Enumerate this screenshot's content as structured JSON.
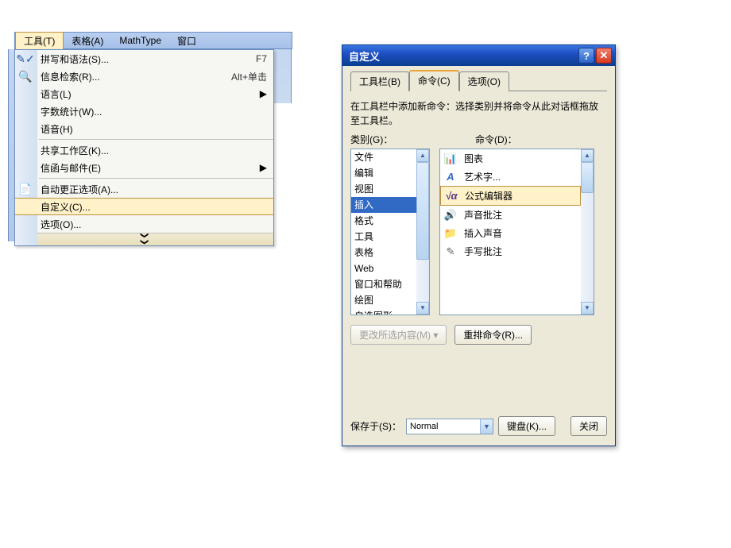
{
  "menubar": {
    "tools": "工具(T)",
    "table": "表格(A)",
    "mathtype": "MathType",
    "window_partial": "窗口"
  },
  "menu": {
    "spelling": {
      "label": "拼写和语法(S)...",
      "shortcut": "F7"
    },
    "research": {
      "label": "信息检索(R)...",
      "shortcut": "Alt+单击"
    },
    "language": {
      "label": "语言(L)"
    },
    "wordcount": {
      "label": "字数统计(W)..."
    },
    "speech": {
      "label": "语音(H)"
    },
    "sharedws": {
      "label": "共享工作区(K)..."
    },
    "letters": {
      "label": "信函与邮件(E)"
    },
    "autocorrect": {
      "label": "自动更正选项(A)..."
    },
    "customize": {
      "label": "自定义(C)..."
    },
    "options": {
      "label": "选项(O)..."
    }
  },
  "dialog": {
    "title": "自定义",
    "tabs": {
      "toolbars": "工具栏(B)",
      "commands": "命令(C)",
      "options": "选项(O)"
    },
    "instruction": "在工具栏中添加新命令：选择类别并将命令从此对话框拖放至工具栏。",
    "category_label": "类别(G)：",
    "commands_label": "命令(D)：",
    "categories": [
      "文件",
      "编辑",
      "视图",
      "插入",
      "格式",
      "工具",
      "表格",
      "Web",
      "窗口和帮助",
      "绘图",
      "自选图形"
    ],
    "category_selected_index": 3,
    "commands": [
      {
        "name": "图表"
      },
      {
        "name": "艺术字..."
      },
      {
        "name": "公式编辑器"
      },
      {
        "name": "声音批注"
      },
      {
        "name": "插入声音"
      },
      {
        "name": "手写批注"
      }
    ],
    "command_selected_index": 2,
    "modify_btn": "更改所选内容(M)",
    "rearrange_btn": "重排命令(R)...",
    "savein_label": "保存于(S)：",
    "savein_value": "Normal",
    "keyboard_btn": "键盘(K)...",
    "close_btn": "关闭"
  },
  "icons": {
    "expand": "❯❯",
    "submenu": "▶",
    "up": "▲",
    "down": "▼"
  }
}
